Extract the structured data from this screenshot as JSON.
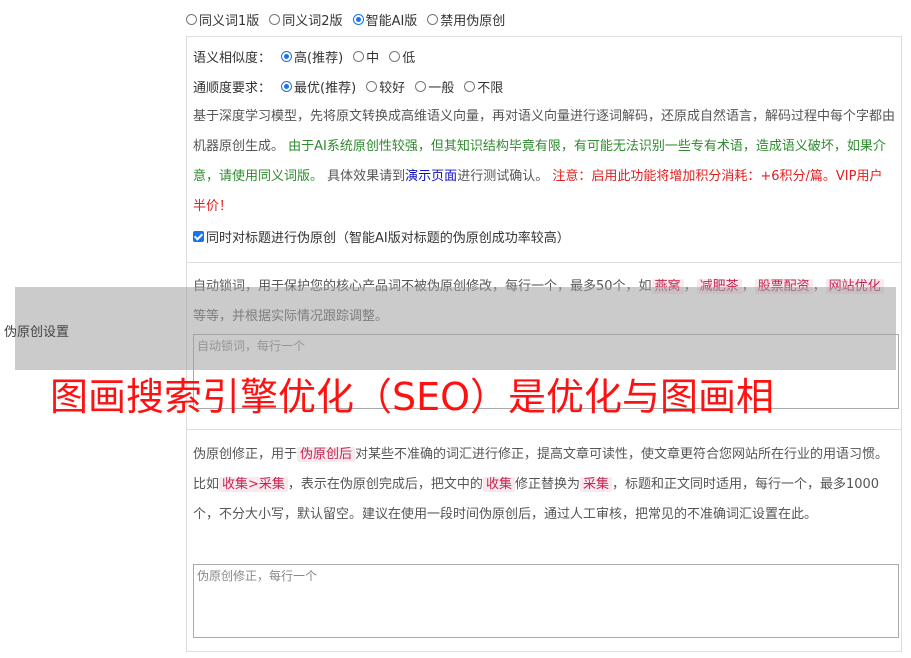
{
  "mode": {
    "options": [
      "同义词1版",
      "同义词2版",
      "智能AI版",
      "禁用伪原创"
    ],
    "selected_index": 2
  },
  "ai": {
    "similarity_label": "语义相似度：",
    "similarity_options": [
      "高(推荐)",
      "中",
      "低"
    ],
    "similarity_selected": 0,
    "fluency_label": "通顺度要求：",
    "fluency_options": [
      "最优(推荐)",
      "较好",
      "一般",
      "不限"
    ],
    "fluency_selected": 0,
    "desc_1": "基于深度学习模型，先将原文转换成高维语义向量，再对语义向量进行逐词解码，还原成自然语言，解码过程中每个字都由机器原创生成。",
    "desc_warn": "由于AI系统原创性较强，但其知识结构毕竟有限，有可能无法识别一些专有术语，造成语义破坏，如果介意，请使用同义词版。",
    "desc_2a": "具体效果请到",
    "desc_link": "演示页面",
    "desc_2b": "进行测试确认。",
    "desc_note": "注意：启用此功能将增加积分消耗：+6积分/篇。VIP用户半价！",
    "title_check_label": "同时对标题进行伪原创（智能AI版对标题的伪原创成功率较高）"
  },
  "lock": {
    "desc_a": "自动锁词，用于保护您的核心产品词不被伪原创修改，每行一个，最多50个，如",
    "tags": [
      "燕窝",
      "减肥茶",
      "股票配资",
      "网站优化"
    ],
    "sep": "，",
    "desc_b": "等等，并根据实际情况跟踪调整。",
    "placeholder": "自动锁词，每行一个"
  },
  "fix": {
    "desc_a": "伪原创修正，用于",
    "tag_1": "伪原创后",
    "desc_b": "对某些不准确的词汇进行修正，提高文章可读性，使文章更符合您网站所在行业的用语习惯。比如",
    "tag_2": "收集>采集",
    "desc_c": "，表示在伪原创完成后，把文中的",
    "tag_3": "收集",
    "desc_d": "修正替换为",
    "tag_4": "采集",
    "desc_e": "，标题和正文同时适用，每行一个，最多1000个，不分大小写，默认留空。建议在使用一段时间伪原创后，通过人工审核，把常见的不准确词汇设置在此。",
    "placeholder": "伪原创修正，每行一个"
  },
  "section_label": "伪原创设置",
  "watermark": "图画搜索引擎优化（SEO）是优化与图画相"
}
